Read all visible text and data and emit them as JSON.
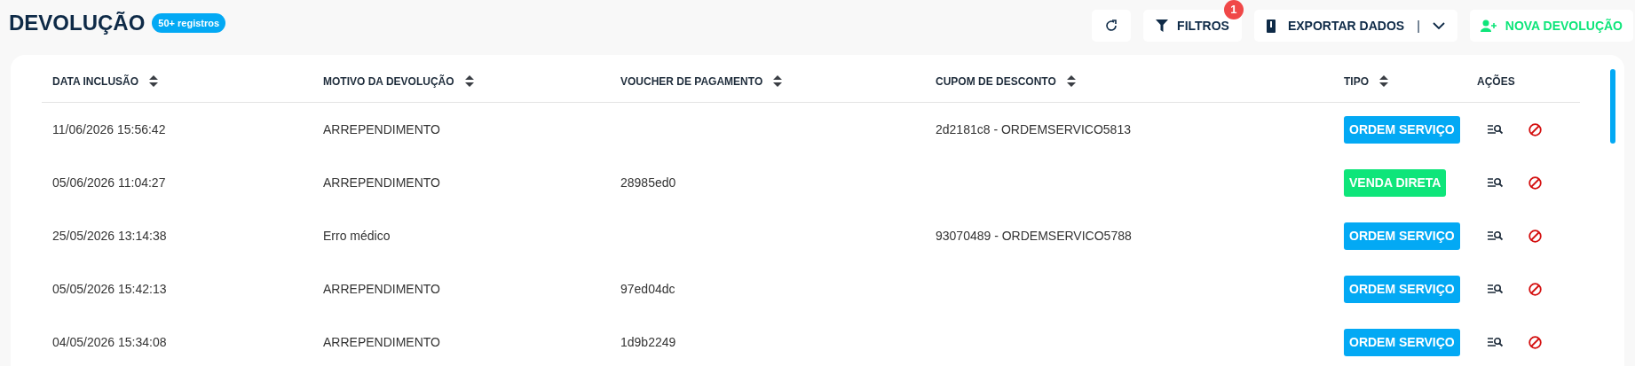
{
  "header": {
    "title": "DEVOLUÇÃO",
    "count_badge": "50+ registros"
  },
  "toolbar": {
    "filters": {
      "label": "FILTROS",
      "badge": "1"
    },
    "export": {
      "label": "EXPORTAR DADOS",
      "separator": "|"
    },
    "new": {
      "label": "NOVA DEVOLUÇÃO"
    }
  },
  "table": {
    "columns": [
      {
        "label": "DATA INCLUSÃO",
        "sortable": true
      },
      {
        "label": "MOTIVO DA DEVOLUÇÃO",
        "sortable": true
      },
      {
        "label": "VOUCHER DE PAGAMENTO",
        "sortable": true
      },
      {
        "label": "CUPOM DE DESCONTO",
        "sortable": true
      },
      {
        "label": "TIPO",
        "sortable": true
      },
      {
        "label": "AÇÕES",
        "sortable": false
      }
    ],
    "rows": [
      {
        "date": "11/06/2026 15:56:42",
        "reason": "ARREPENDIMENTO",
        "voucher": "",
        "coupon": "2d2181c8 - ORDEMSERVICO5813",
        "type": {
          "label": "ORDEM SERVIÇO",
          "color": "#03a9f4"
        }
      },
      {
        "date": "05/06/2026 11:04:27",
        "reason": "ARREPENDIMENTO",
        "voucher": "28985ed0",
        "coupon": "",
        "type": {
          "label": "VENDA DIRETA",
          "color": "#0ee57a"
        }
      },
      {
        "date": "25/05/2026 13:14:38",
        "reason": "Erro médico",
        "voucher": "",
        "coupon": "93070489 - ORDEMSERVICO5788",
        "type": {
          "label": "ORDEM SERVIÇO",
          "color": "#03a9f4"
        }
      },
      {
        "date": "05/05/2026 15:42:13",
        "reason": "ARREPENDIMENTO",
        "voucher": "97ed04dc",
        "coupon": "",
        "type": {
          "label": "ORDEM SERVIÇO",
          "color": "#03a9f4"
        }
      },
      {
        "date": "04/05/2026 15:34:08",
        "reason": "ARREPENDIMENTO",
        "voucher": "1d9b2249",
        "coupon": "",
        "type": {
          "label": "ORDEM SERVIÇO",
          "color": "#03a9f4"
        }
      }
    ]
  }
}
